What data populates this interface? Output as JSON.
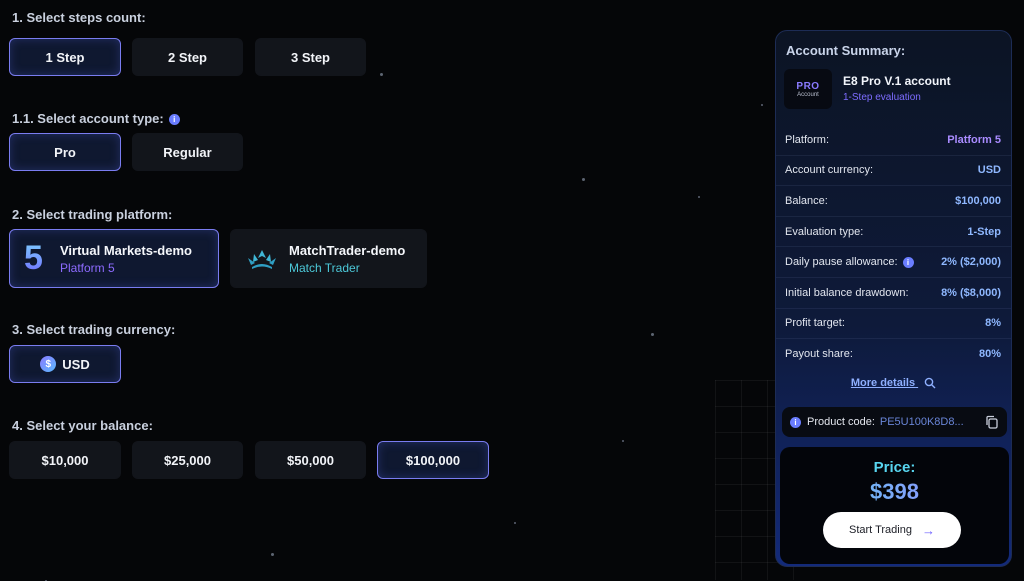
{
  "steps": {
    "title": "1. Select steps count:",
    "options": [
      "1 Step",
      "2 Step",
      "3 Step"
    ]
  },
  "account_type": {
    "title": "1.1. Select account type:",
    "info_icon": "info-icon",
    "options": [
      "Pro",
      "Regular"
    ]
  },
  "platform": {
    "title": "2. Select trading platform:",
    "options": [
      {
        "name": "Virtual Markets-demo",
        "sub": "Platform 5",
        "logo": "5"
      },
      {
        "name": "MatchTrader-demo",
        "sub": "Match Trader"
      }
    ]
  },
  "currency": {
    "title": "3. Select trading currency:",
    "coin_symbol": "$",
    "options": [
      "USD"
    ]
  },
  "balance": {
    "title": "4. Select your balance:",
    "options": [
      "$10,000",
      "$25,000",
      "$50,000",
      "$100,000"
    ]
  },
  "summary": {
    "title": "Account Summary:",
    "logo_top": "PRO",
    "logo_bottom": "Account",
    "account_name": "E8 Pro V.1 account",
    "account_sub": "1-Step evaluation",
    "rows": [
      {
        "label": "Platform:",
        "value": "Platform 5"
      },
      {
        "label": "Account currency:",
        "value": "USD"
      },
      {
        "label": "Balance:",
        "value": "$100,000"
      },
      {
        "label": "Evaluation type:",
        "value": "1-Step"
      },
      {
        "label": "Daily pause allowance:",
        "value": "2% ($2,000)"
      },
      {
        "label": "Initial balance drawdown:",
        "value": "8% ($8,000)"
      },
      {
        "label": "Profit target:",
        "value": "8%"
      },
      {
        "label": "Payout share:",
        "value": "80%"
      }
    ],
    "more_details": "More details",
    "product_code_label": "Product code:",
    "product_code": "PE5U100K8D8...",
    "price_label": "Price:",
    "price_value": "$398",
    "start_button": "Start Trading",
    "start_arrow": "→"
  }
}
